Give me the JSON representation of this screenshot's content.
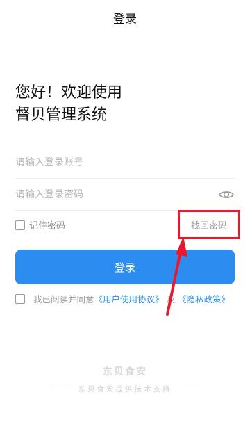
{
  "header": {
    "title": "登录"
  },
  "greeting": {
    "line1": "您好！欢迎使用",
    "line2": "督贝管理系统"
  },
  "form": {
    "account_placeholder": "请输入登录账号",
    "password_placeholder": "请输入登录密码",
    "remember_label": "记住密码",
    "forgot_label": "找回密码",
    "login_label": "登录",
    "eye_icon": "eye-icon"
  },
  "agreement": {
    "prefix": "我已阅读并同意",
    "user_agreement": "《用户使用协议》",
    "and": "及",
    "privacy": "《隐私政策》"
  },
  "footer": {
    "brand": "东贝食安",
    "support": "东贝食安提供技术支持"
  },
  "colors": {
    "accent": "#2d8cf0",
    "highlight": "#e8192c"
  }
}
